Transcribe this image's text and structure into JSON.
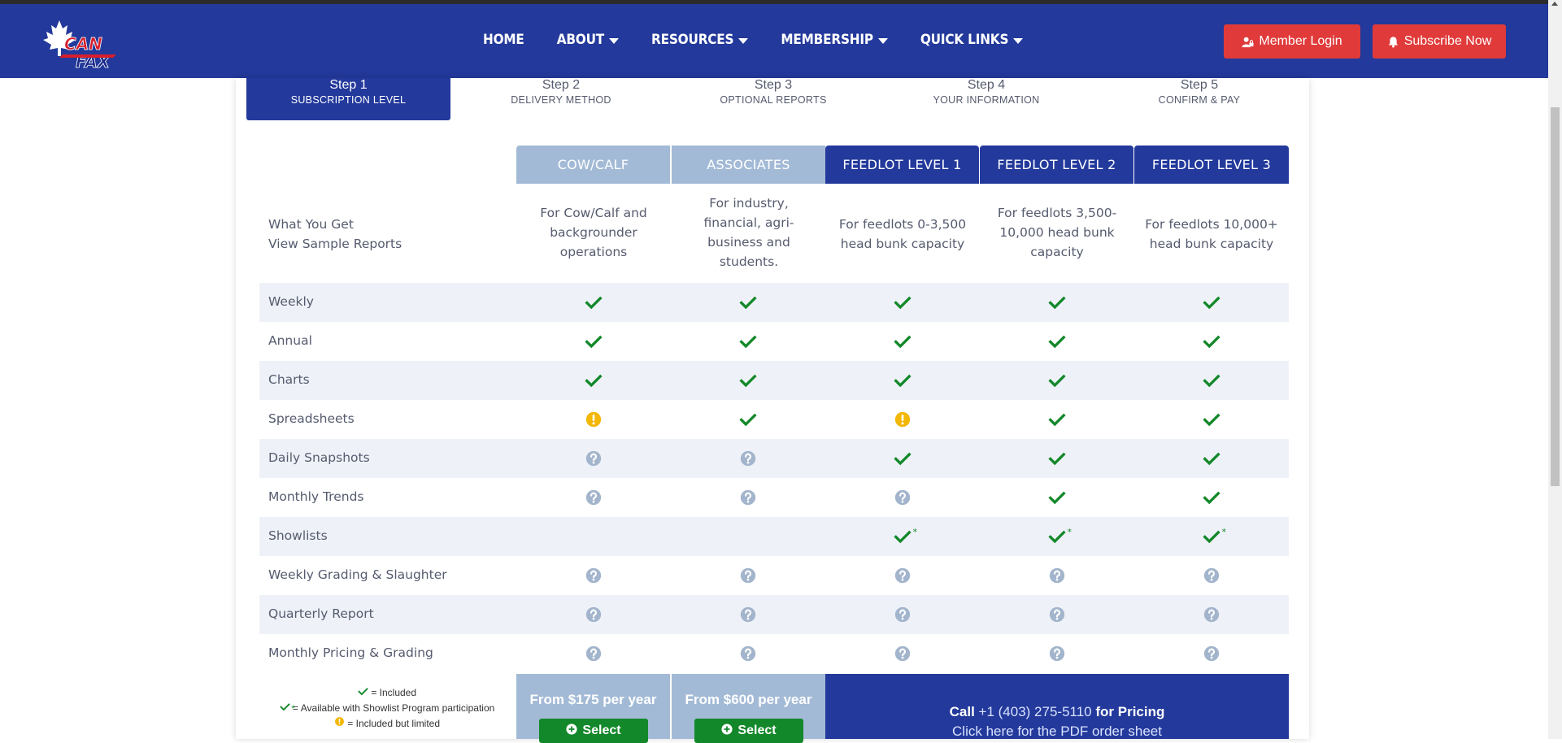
{
  "nav": {
    "logo_text": "CAN FAX",
    "items": [
      {
        "label": "HOME",
        "dropdown": false
      },
      {
        "label": "ABOUT",
        "dropdown": true
      },
      {
        "label": "RESOURCES",
        "dropdown": true
      },
      {
        "label": "MEMBERSHIP",
        "dropdown": true
      },
      {
        "label": "QUICK LINKS",
        "dropdown": true
      }
    ],
    "login_label": "Member Login",
    "subscribe_label": "Subscribe Now",
    "bar_color": "#23399b",
    "button_color": "#e03a3a"
  },
  "steps": [
    {
      "title": "Step 1",
      "sub": "SUBSCRIPTION LEVEL",
      "active": true
    },
    {
      "title": "Step 2",
      "sub": "DELIVERY METHOD",
      "active": false
    },
    {
      "title": "Step 3",
      "sub": "OPTIONAL REPORTS",
      "active": false
    },
    {
      "title": "Step 4",
      "sub": "YOUR INFORMATION",
      "active": false
    },
    {
      "title": "Step 5",
      "sub": "CONFIRM & PAY",
      "active": false
    }
  ],
  "plans": [
    {
      "name": "COW/CALF",
      "desc": [
        "For Cow/Calf and",
        "backgrounder",
        "operations"
      ]
    },
    {
      "name": "ASSOCIATES",
      "desc": [
        "For industry,",
        "financial, agri-",
        "business and",
        "students."
      ]
    },
    {
      "name": "FEEDLOT LEVEL 1",
      "desc": [
        "For feedlots 0-3,500",
        "head bunk capacity"
      ]
    },
    {
      "name": "FEEDLOT LEVEL 2",
      "desc": [
        "For feedlots 3,500-",
        "10,000 head bunk",
        "capacity"
      ]
    },
    {
      "name": "FEEDLOT LEVEL 3",
      "desc": [
        "For feedlots 10,000+",
        "head bunk capacity"
      ]
    }
  ],
  "what_you_get": "What You Get",
  "view_sample": "View Sample Reports",
  "features": [
    {
      "label": "Weekly",
      "values": [
        "check",
        "check",
        "check",
        "check",
        "check"
      ]
    },
    {
      "label": "Annual",
      "values": [
        "check",
        "check",
        "check",
        "check",
        "check"
      ]
    },
    {
      "label": "Charts",
      "values": [
        "check",
        "check",
        "check",
        "check",
        "check"
      ]
    },
    {
      "label": "Spreadsheets",
      "values": [
        "limited",
        "check",
        "limited",
        "check",
        "check"
      ]
    },
    {
      "label": "Daily Snapshots",
      "values": [
        "optional",
        "optional",
        "check",
        "check",
        "check"
      ]
    },
    {
      "label": "Monthly Trends",
      "values": [
        "optional",
        "optional",
        "optional",
        "check",
        "check"
      ]
    },
    {
      "label": "Showlists",
      "values": [
        "none",
        "none",
        "showlist",
        "showlist",
        "showlist"
      ]
    },
    {
      "label": "Weekly Grading & Slaughter",
      "values": [
        "optional",
        "optional",
        "optional",
        "optional",
        "optional"
      ]
    },
    {
      "label": "Quarterly Report",
      "values": [
        "optional",
        "optional",
        "optional",
        "optional",
        "optional"
      ]
    },
    {
      "label": "Monthly Pricing & Grading",
      "values": [
        "optional",
        "optional",
        "optional",
        "optional",
        "optional"
      ]
    }
  ],
  "legend": {
    "included": "= Included",
    "showlist": "= Available with Showlist Program participation",
    "limited": "= Included but limited"
  },
  "pricing": {
    "cowcalf": "From $175 per year",
    "associates": "From $600 per year",
    "select_label": "Select",
    "call_prefix": "Call",
    "phone": "+1 (403) 275-5110",
    "call_suffix": "for Pricing",
    "pdf_link": "Click here for the PDF order sheet"
  },
  "colors": {
    "check": "#13882a",
    "limited": "#f2b707",
    "optional": "#a3b5cc",
    "light_header": "#a3bad6",
    "dark_header": "#23399b",
    "row_shade": "#eef2f8"
  }
}
